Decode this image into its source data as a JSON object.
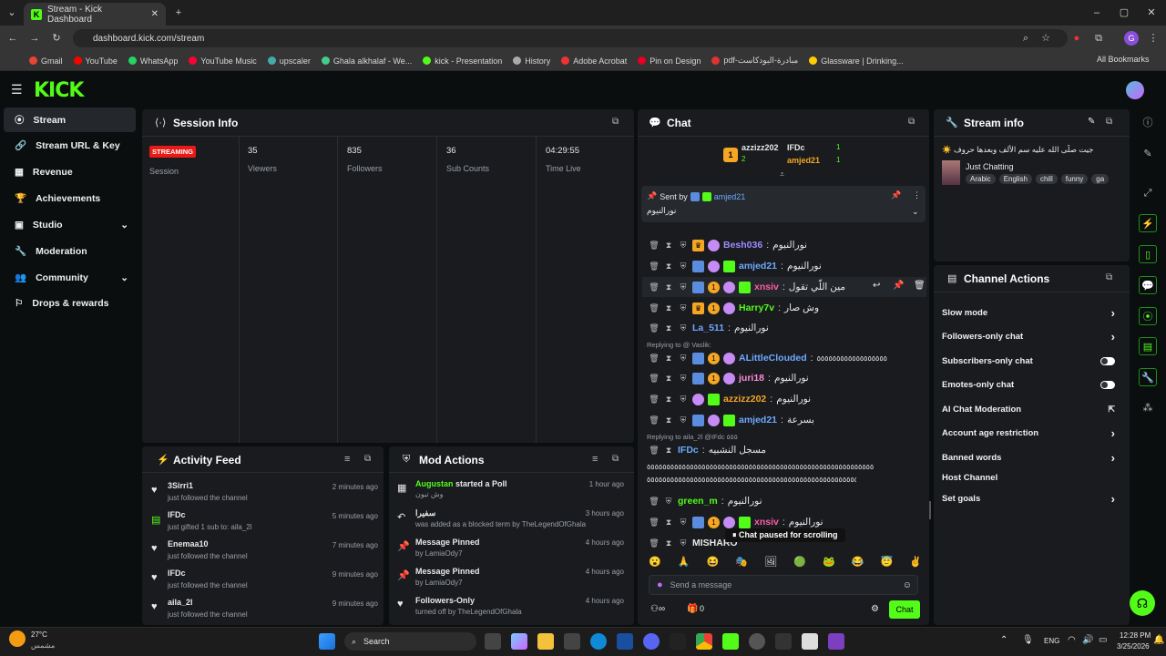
{
  "browser": {
    "tab_title": "Stream - Kick Dashboard",
    "url": "dashboard.kick.com/stream",
    "bookmarks": [
      "Gmail",
      "YouTube",
      "WhatsApp",
      "YouTube Music",
      "upscaler",
      "Ghala alkhalaf - We...",
      "kick - Presentation",
      "History",
      "Adobe Acrobat",
      "Pin on Design",
      "pdf-مبادرة-البودكاست",
      "Glassware | Drinking..."
    ],
    "all_bookmarks": "All Bookmarks",
    "profile_letter": "G"
  },
  "kick": {
    "logo": "KICK"
  },
  "sidebar": {
    "items": [
      {
        "label": "Stream",
        "icon": "broadcast-icon"
      },
      {
        "label": "Stream URL & Key",
        "icon": "link-icon"
      },
      {
        "label": "Revenue",
        "icon": "revenue-icon"
      },
      {
        "label": "Achievements",
        "icon": "trophy-icon"
      },
      {
        "label": "Studio",
        "icon": "studio-icon"
      },
      {
        "label": "Moderation",
        "icon": "wrench-icon"
      },
      {
        "label": "Community",
        "icon": "community-icon"
      },
      {
        "label": "Drops & rewards",
        "icon": "drops-icon"
      }
    ]
  },
  "session": {
    "title": "Session Info",
    "status": "STREAMING",
    "status_label": "Session",
    "stats": [
      {
        "value": "35",
        "label": "Viewers"
      },
      {
        "value": "835",
        "label": "Followers"
      },
      {
        "value": "36",
        "label": "Sub Counts"
      },
      {
        "value": "04:29:55",
        "label": "Time Live"
      }
    ]
  },
  "activity": {
    "title": "Activity Feed",
    "items": [
      {
        "name": "3Sirri1",
        "action": "just followed the channel",
        "time": "2 minutes ago"
      },
      {
        "name": "IFDc",
        "action": "just gifted 1 sub to: aila_2l",
        "time": "5 minutes ago"
      },
      {
        "name": "Enemaa10",
        "action": "just followed the channel",
        "time": "7 minutes ago"
      },
      {
        "name": "IFDc",
        "action": "just followed the channel",
        "time": "9 minutes ago"
      },
      {
        "name": "aila_2l",
        "action": "just followed the channel",
        "time": "9 minutes ago"
      }
    ]
  },
  "mod": {
    "title": "Mod Actions",
    "items": [
      {
        "head": "Augustan",
        "head2": "started a Poll",
        "sub": "وش تبون",
        "time": "1 hour ago"
      },
      {
        "head": "سفيرا",
        "head2": "",
        "sub": "was added as a blocked term by TheLegendOfGhala",
        "time": "3 hours ago"
      },
      {
        "head": "Message Pinned",
        "head2": "",
        "sub": "by LamiaOdy7",
        "time": "4 hours ago"
      },
      {
        "head": "Message Pinned",
        "head2": "",
        "sub": "by LamiaOdy7",
        "time": "4 hours ago"
      },
      {
        "head": "Followers-Only",
        "head2": "",
        "sub": "turned off by TheLegendOfGhala",
        "time": "4 hours ago"
      }
    ]
  },
  "chat": {
    "title": "Chat",
    "top": [
      {
        "name": "azzizz202",
        "n": "2"
      },
      {
        "name": "IFDc",
        "n": "1"
      },
      {
        "name": "amjed21",
        "n": "1"
      }
    ],
    "pinned": {
      "sent_by": "Sent by",
      "user": "amjed21",
      "text": "نورالنيوم"
    },
    "messages": [
      {
        "user": "Besh036",
        "color": "#9b8cff",
        "text": "نورالنيوم"
      },
      {
        "user": "amjed21",
        "color": "#6fa8ff",
        "text": "نورالنيوم"
      },
      {
        "user": "xnsiv",
        "color": "#ff5ca8",
        "text": "مين اللّي تقول"
      },
      {
        "user": "Harry7v",
        "color": "#53fc18",
        "text": "وش صار"
      },
      {
        "user": "La_511",
        "color": "#6fa8ff",
        "text": "نورالنيوم"
      },
      {
        "user": "ALittleClouded",
        "color": "#6fa8ff",
        "text": "٥٥٥٥٥٥٥٥٥٥٥٥٥٥٥٥٥٥"
      },
      {
        "user": "juri18",
        "color": "#ff8ad8",
        "text": "نورالنيوم"
      },
      {
        "user": "azzizz202",
        "color": "#f5a623",
        "text": "نورالنيوم"
      },
      {
        "user": "amjed21",
        "color": "#6fa8ff",
        "text": "بسرعة"
      },
      {
        "user": "IFDc",
        "color": "#6fa8ff",
        "text": "مسجل النشبيه"
      },
      {
        "user": "green_m",
        "color": "#53fc18",
        "text": "نورالنيوم"
      },
      {
        "user": "xnsiv",
        "color": "#ff5ca8",
        "text": "نورالنيوم"
      },
      {
        "user": "MISHARO",
        "color": "#e8e8e8",
        "text": ""
      }
    ],
    "long_line": "٥٥٥٥٥٥٥٥٥٥٥٥٥٥٥٥٥٥٥٥٥٥٥٥٥٥٥٥٥٥٥٥٥٥٥٥٥٥٥٥٥٥٥٥٥٥٥٥٥٥٥٥٥٥٥٥٥٥",
    "replying1": "Replying to @ Vaslik:",
    "replying2": "Replying to aila_2l @IFdc ٥٥٥",
    "paused": "Chat paused for scrolling",
    "placeholder": "Send a message",
    "send": "Chat",
    "count": "0"
  },
  "streaminfo": {
    "title": "Stream info",
    "stream_title": "☀️ جيت صلّى الله عليه سم الألف وبعدها حروف",
    "category": "Just Chatting",
    "tags": [
      "Arabic",
      "English",
      "chill",
      "funny",
      "ga"
    ]
  },
  "channel": {
    "title": "Channel Actions",
    "items": [
      {
        "label": "Slow mode",
        "ctl": "chevron"
      },
      {
        "label": "Followers-only chat",
        "ctl": "chevron"
      },
      {
        "label": "Subscribers-only chat",
        "ctl": "toggle"
      },
      {
        "label": "Emotes-only chat",
        "ctl": "toggle"
      },
      {
        "label": "AI Chat Moderation",
        "ctl": "external"
      },
      {
        "label": "Account age restriction",
        "ctl": "chevron"
      },
      {
        "label": "Banned words",
        "ctl": "chevron"
      },
      {
        "label": "Host Channel",
        "ctl": "none"
      },
      {
        "label": "Set goals",
        "ctl": "chevron"
      }
    ]
  },
  "taskbar": {
    "temp": "27°C",
    "weather": "مشمس",
    "search": "Search",
    "lang": "ENG",
    "time": "12:28 PM",
    "date": "3/25/2026"
  }
}
